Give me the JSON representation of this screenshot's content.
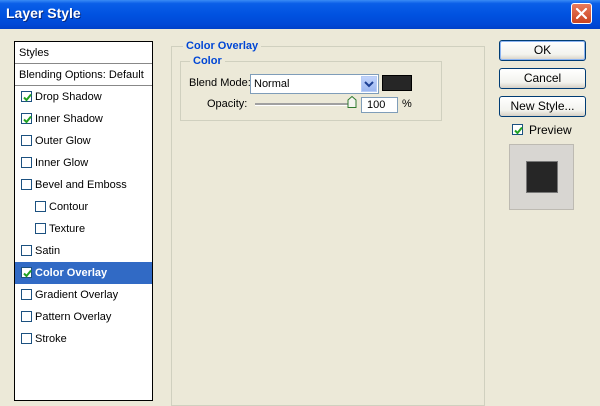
{
  "window": {
    "title": "Layer Style"
  },
  "styles_list": {
    "header": "Styles",
    "items": [
      {
        "label": "Blending Options: Default",
        "checkbox": false,
        "checked": false,
        "indent": 0,
        "selected": false
      },
      {
        "label": "Drop Shadow",
        "checkbox": true,
        "checked": true,
        "indent": 0,
        "selected": false
      },
      {
        "label": "Inner Shadow",
        "checkbox": true,
        "checked": true,
        "indent": 0,
        "selected": false
      },
      {
        "label": "Outer Glow",
        "checkbox": true,
        "checked": false,
        "indent": 0,
        "selected": false
      },
      {
        "label": "Inner Glow",
        "checkbox": true,
        "checked": false,
        "indent": 0,
        "selected": false
      },
      {
        "label": "Bevel and Emboss",
        "checkbox": true,
        "checked": false,
        "indent": 0,
        "selected": false
      },
      {
        "label": "Contour",
        "checkbox": true,
        "checked": false,
        "indent": 1,
        "selected": false
      },
      {
        "label": "Texture",
        "checkbox": true,
        "checked": false,
        "indent": 1,
        "selected": false
      },
      {
        "label": "Satin",
        "checkbox": true,
        "checked": false,
        "indent": 0,
        "selected": false
      },
      {
        "label": "Color Overlay",
        "checkbox": true,
        "checked": true,
        "indent": 0,
        "selected": true
      },
      {
        "label": "Gradient Overlay",
        "checkbox": true,
        "checked": false,
        "indent": 0,
        "selected": false
      },
      {
        "label": "Pattern Overlay",
        "checkbox": true,
        "checked": false,
        "indent": 0,
        "selected": false
      },
      {
        "label": "Stroke",
        "checkbox": true,
        "checked": false,
        "indent": 0,
        "selected": false
      }
    ]
  },
  "panel": {
    "group_title": "Color Overlay",
    "subgroup_title": "Color",
    "blend_mode_label": "Blend Mode:",
    "blend_mode_value": "Normal",
    "overlay_color": "#262626",
    "opacity_label": "Opacity:",
    "opacity_value": "100",
    "opacity_unit": "%",
    "opacity_level": 1.0
  },
  "buttons": {
    "ok": "OK",
    "cancel": "Cancel",
    "new_style": "New Style..."
  },
  "preview": {
    "label": "Preview",
    "checked": true
  },
  "icons": {
    "close": "close-icon",
    "dropdown": "chevron-down-icon",
    "slider": "slider-thumb-icon"
  },
  "colors": {
    "titlebar": "#0052E0",
    "selection": "#316AC5",
    "legend": "#0046D5",
    "close": "#C9431F"
  }
}
